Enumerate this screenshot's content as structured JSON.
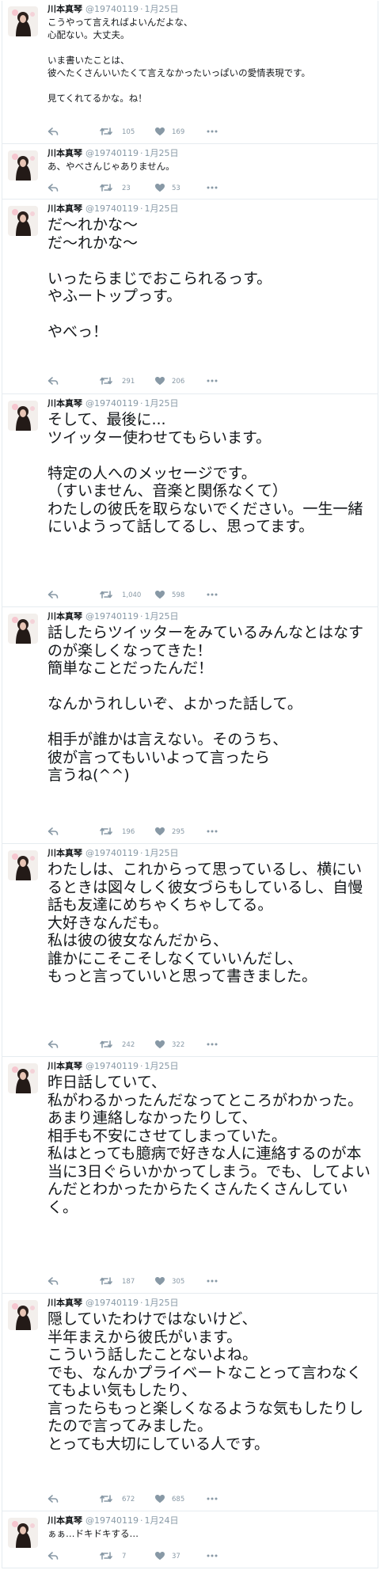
{
  "tweets": [
    {
      "name": "川本真琴",
      "handle": "@19740119",
      "date": "1月25日",
      "text": "こうやって言えればよいんだよな、\n心配ない。大丈夫。\n\nいま書いたことは、\n彼へたくさんいいたくて言えなかったいっぱいの愛情表現です。\n\n見てくれてるかな。ね！",
      "retweets": "105",
      "likes": "169"
    },
    {
      "name": "川本真琴",
      "handle": "@19740119",
      "date": "1月25日",
      "text": "あ、やべさんじゃありません。",
      "retweets": "23",
      "likes": "53"
    },
    {
      "name": "川本真琴",
      "handle": "@19740119",
      "date": "1月25日",
      "text": "だ〜れかな〜\nだ〜れかな〜\n\nいったらまじでおこられるっす。\nやふートップっす。\n\nやべっ！",
      "retweets": "291",
      "likes": "206"
    },
    {
      "name": "川本真琴",
      "handle": "@19740119",
      "date": "1月25日",
      "text": "そして、最後に...\nツイッター使わせてもらいます。\n\n特定の人へのメッセージです。\n（すいません、音楽と関係なくて）\nわたしの彼氏を取らないでください。一生一緒にいようって話してるし、思ってます。",
      "retweets": "1,040",
      "likes": "598"
    },
    {
      "name": "川本真琴",
      "handle": "@19740119",
      "date": "1月25日",
      "text": "話したらツイッターをみているみんなとはなすのが楽しくなってきた！\n簡単なことだったんだ！\n\nなんかうれしいぞ、よかった話して。\n\n相手が誰かは言えない。そのうち、\n彼が言ってもいいよって言ったら\n言うね(^^)",
      "retweets": "196",
      "likes": "295"
    },
    {
      "name": "川本真琴",
      "handle": "@19740119",
      "date": "1月25日",
      "text": "わたしは、これからって思っているし、横にいるときは図々しく彼女づらもしているし、自慢話も友達にめちゃくちゃしてる。\n大好きなんだも。\n私は彼の彼女なんだから、\n誰かにこそこそしなくていいんだし、\nもっと言っていいと思って書きました。",
      "retweets": "242",
      "likes": "322"
    },
    {
      "name": "川本真琴",
      "handle": "@19740119",
      "date": "1月25日",
      "text": "昨日話していて、\n私がわるかったんだなってところがわかった。\nあまり連絡しなかったりして、\n相手も不安にさせてしまっていた。\n私はとっても臆病で好きな人に連絡するのが本当に3日ぐらいかかってしまう。でも、してよいんだとわかったからたくさんたくさんしていく。",
      "retweets": "187",
      "likes": "305"
    },
    {
      "name": "川本真琴",
      "handle": "@19740119",
      "date": "1月25日",
      "text": "隠していたわけではないけど、\n半年まえから彼氏がいます。\nこういう話したことないよね。\nでも、なんかプライベートなことって言わなくてもよい気もしたり、\n言ったらもっと楽しくなるような気もしたりしたので言ってみました。\nとっても大切にしている人です。",
      "retweets": "672",
      "likes": "685"
    },
    {
      "name": "川本真琴",
      "handle": "@19740119",
      "date": "1月24日",
      "text": "ぁぁ…ドキドキする…",
      "retweets": "7",
      "likes": "37"
    }
  ],
  "icons": {
    "avatar": "avatar-photo",
    "reply": "reply-icon",
    "retweet": "retweet-icon",
    "like": "heart-icon",
    "more": "more-dots-icon"
  },
  "colors": {
    "name": "#14171a",
    "meta": "#8899a6",
    "text": "#14171a",
    "divider": "#e6ecf0"
  }
}
